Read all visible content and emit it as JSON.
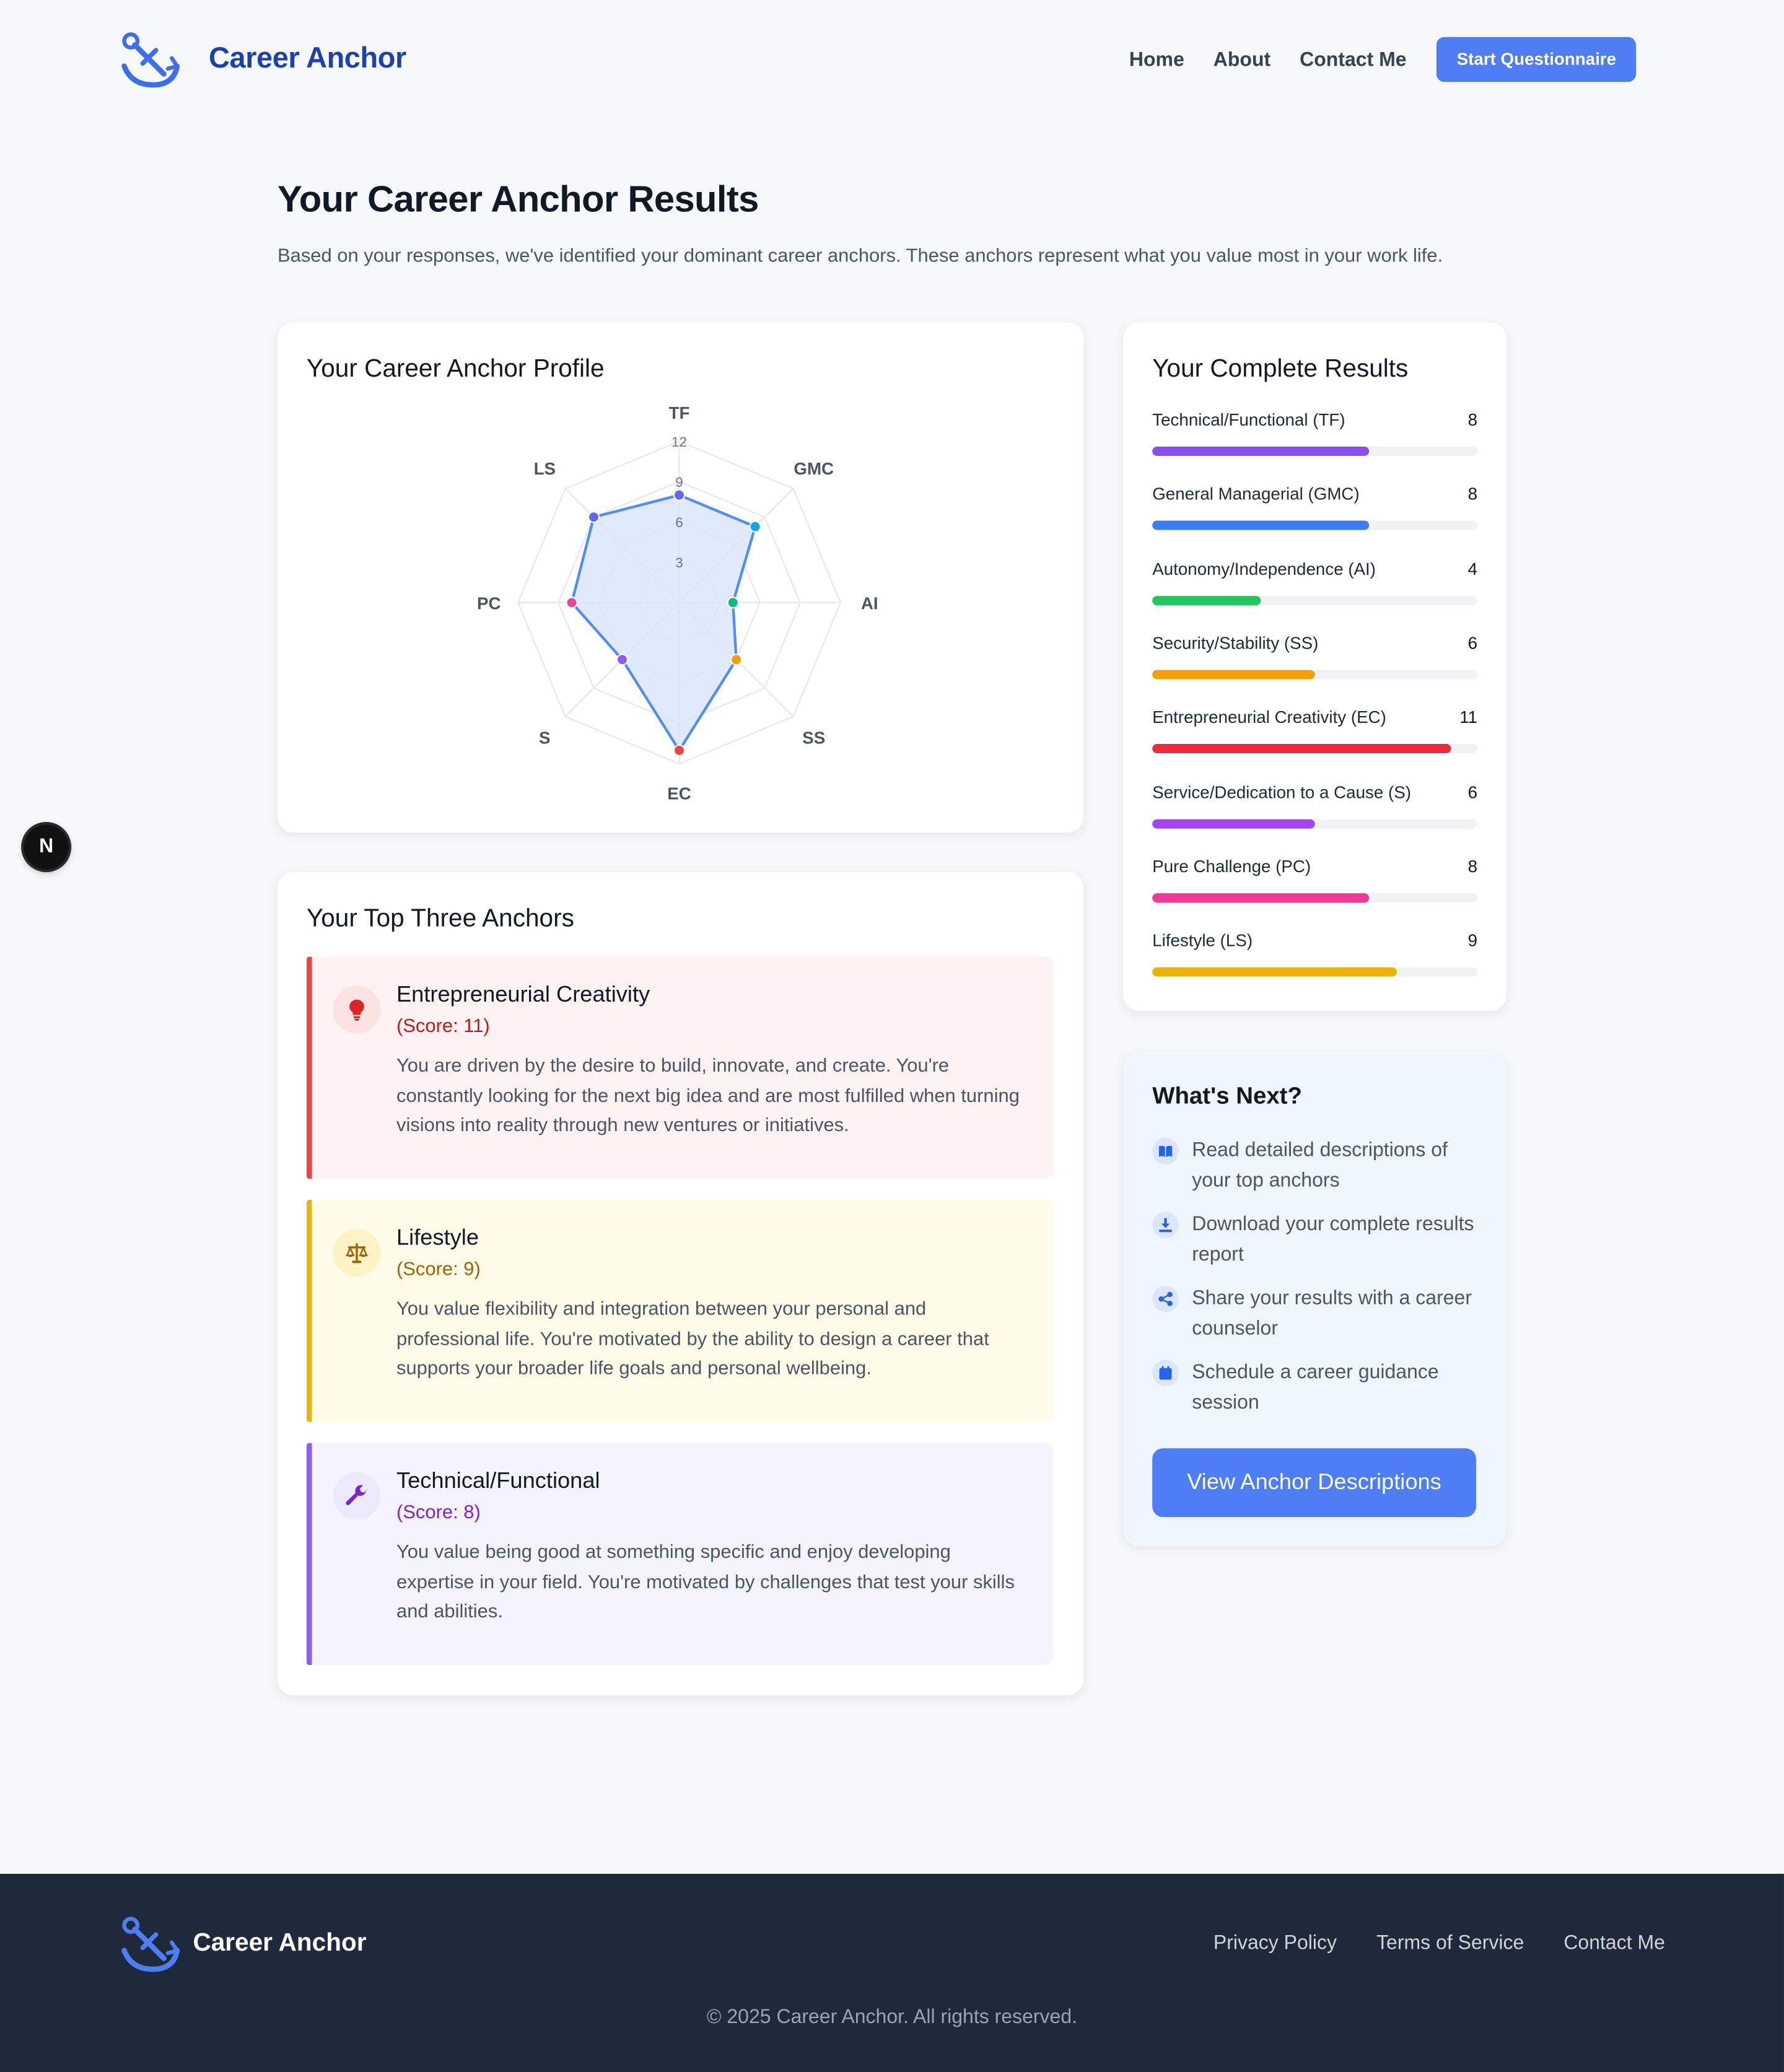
{
  "header": {
    "brand": "Career Anchor",
    "nav": [
      "Home",
      "About",
      "Contact Me"
    ],
    "cta": "Start Questionnaire"
  },
  "intro": {
    "title": "Your Career Anchor Results",
    "subtitle": "Based on your responses, we've identified your dominant career anchors. These anchors represent what you value most in your work life."
  },
  "profile": {
    "title": "Your Career Anchor Profile"
  },
  "chart_data": {
    "type": "radar",
    "title": "Your Career Anchor Profile",
    "axes": [
      "TF",
      "GMC",
      "AI",
      "SS",
      "EC",
      "S",
      "PC",
      "LS"
    ],
    "values": [
      8,
      8,
      4,
      6,
      11,
      6,
      8,
      9
    ],
    "ticks": [
      3,
      6,
      9,
      12
    ],
    "rmax": 12,
    "point_colors": [
      "#6366f1",
      "#0ea5e9",
      "#10b981",
      "#f59e0b",
      "#ef4444",
      "#8b5cf6",
      "#ec4899",
      "#6366f1"
    ],
    "line_color": "#4f8ef7",
    "fill_color": "#dbe6fb"
  },
  "results": {
    "title": "Your Complete Results",
    "max": 12,
    "items": [
      {
        "label": "Technical/Functional (TF)",
        "value": "8",
        "score": 8,
        "color": "#8b4cf0"
      },
      {
        "label": "General Managerial (GMC)",
        "value": "8",
        "score": 8,
        "color": "#3b7ef0"
      },
      {
        "label": "Autonomy/Independence (AI)",
        "value": "4",
        "score": 4,
        "color": "#22c55e"
      },
      {
        "label": "Security/Stability (SS)",
        "value": "6",
        "score": 6,
        "color": "#f59e0b"
      },
      {
        "label": "Entrepreneurial Creativity (EC)",
        "value": "11",
        "score": 11,
        "color": "#ef2a3a"
      },
      {
        "label": "Service/Dedication to a Cause (S)",
        "value": "6",
        "score": 6,
        "color": "#a744f0"
      },
      {
        "label": "Pure Challenge (PC)",
        "value": "8",
        "score": 8,
        "color": "#ec3a9a"
      },
      {
        "label": "Lifestyle (LS)",
        "value": "9",
        "score": 9,
        "color": "#eab308"
      }
    ]
  },
  "top": {
    "title": "Your Top Three Anchors",
    "anchors": [
      {
        "name": "Entrepreneurial Creativity",
        "score": "(Score: 11)",
        "desc": "You are driven by the desire to build, innovate, and create. You're constantly looking for the next big idea and are most fulfilled when turning visions into reality through new ventures or initiatives.",
        "icon": "lightbulb-icon"
      },
      {
        "name": "Lifestyle",
        "score": "(Score: 9)",
        "desc": "You value flexibility and integration between your personal and professional life. You're motivated by the ability to design a career that supports your broader life goals and personal wellbeing.",
        "icon": "balance-scale-icon"
      },
      {
        "name": "Technical/Functional",
        "score": "(Score: 8)",
        "desc": "You value being good at something specific and enjoy developing expertise in your field. You're motivated by challenges that test your skills and abilities.",
        "icon": "wrench-icon"
      }
    ]
  },
  "next": {
    "title": "What's Next?",
    "items": [
      "Read detailed descriptions of your top anchors",
      "Download your complete results report",
      "Share your results with a career counselor",
      "Schedule a career guidance session"
    ],
    "button": "View Anchor Descriptions"
  },
  "badge": "N",
  "footer": {
    "brand": "Career Anchor",
    "links": [
      "Privacy Policy",
      "Terms of Service",
      "Contact Me"
    ],
    "copyright": "© 2025 Career Anchor. All rights reserved."
  }
}
